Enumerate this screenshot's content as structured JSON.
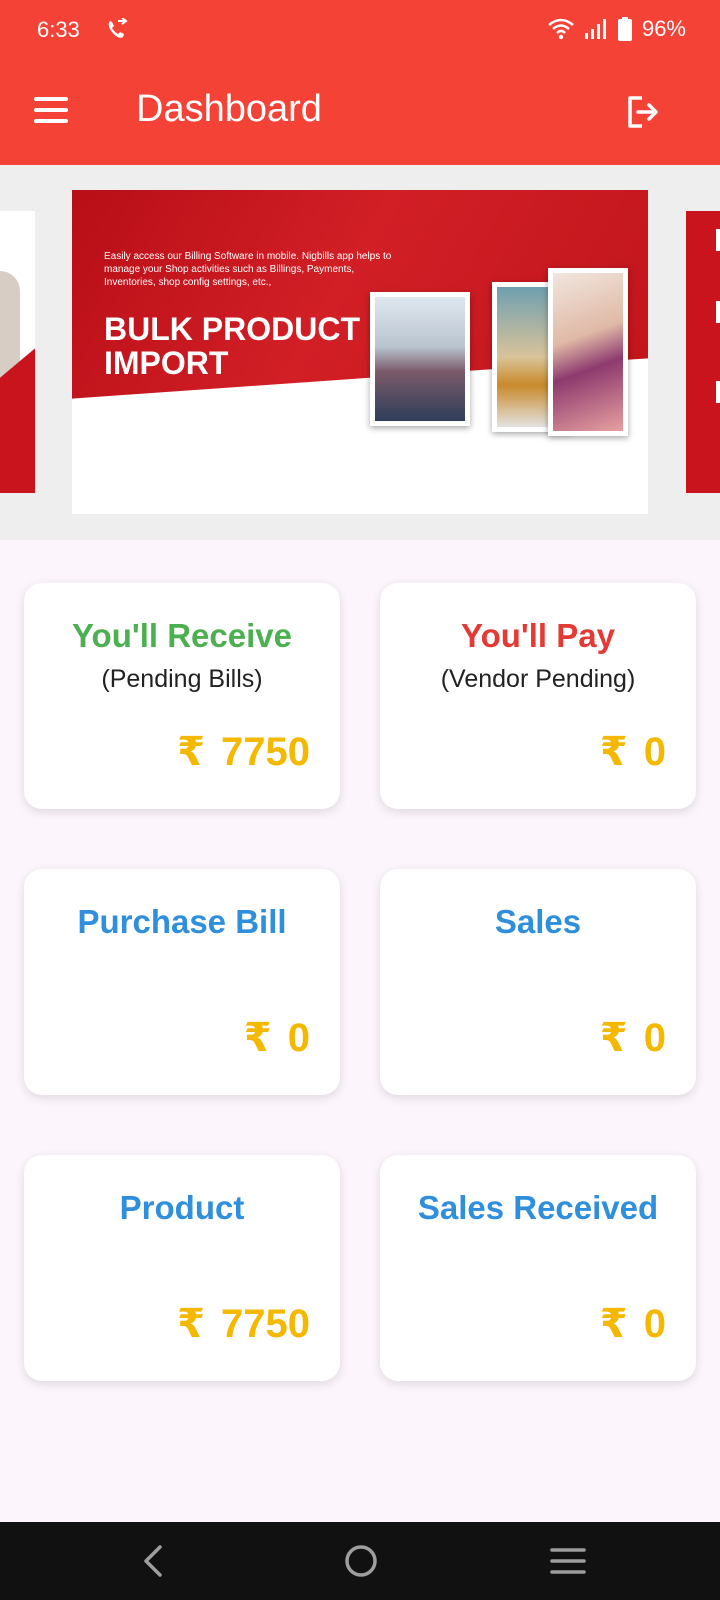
{
  "status_bar": {
    "time": "6:33",
    "battery": "96%",
    "icons": [
      "call-forward-icon",
      "wifi-icon",
      "signal-icon",
      "battery-icon"
    ]
  },
  "app_bar": {
    "title": "Dashboard",
    "menu_icon": "menu-icon",
    "logout_icon": "logout-icon",
    "background": "#f44336"
  },
  "banner": {
    "description": "Easily access our Billing Software in mobile. Nigbills app helps to manage your Shop activities such as Billings, Payments, Inventories, shop config settings, etc.,",
    "heading_line1": "BULK PRODUCT",
    "heading_line2": "IMPORT"
  },
  "cards": [
    {
      "title": "You'll Receive",
      "subtitle": "(Pending Bills)",
      "currency": "₹",
      "amount": "7750",
      "title_color": "#4caf50"
    },
    {
      "title": "You'll Pay",
      "subtitle": "(Vendor Pending)",
      "currency": "₹",
      "amount": "0",
      "title_color": "#e53935"
    },
    {
      "title": "Purchase Bill",
      "subtitle": "",
      "currency": "₹",
      "amount": "0",
      "title_color": "#2f8fdd"
    },
    {
      "title": "Sales",
      "subtitle": "",
      "currency": "₹",
      "amount": "0",
      "title_color": "#2f8fdd"
    },
    {
      "title": "Product",
      "subtitle": "",
      "currency": "₹",
      "amount": "7750",
      "title_color": "#2f8fdd"
    },
    {
      "title": "Sales Received",
      "subtitle": "",
      "currency": "₹",
      "amount": "0",
      "title_color": "#2f8fdd"
    }
  ],
  "amount_color": "#f5b800",
  "nav_bar": {
    "buttons": [
      "back-icon",
      "home-icon",
      "recents-icon"
    ]
  }
}
